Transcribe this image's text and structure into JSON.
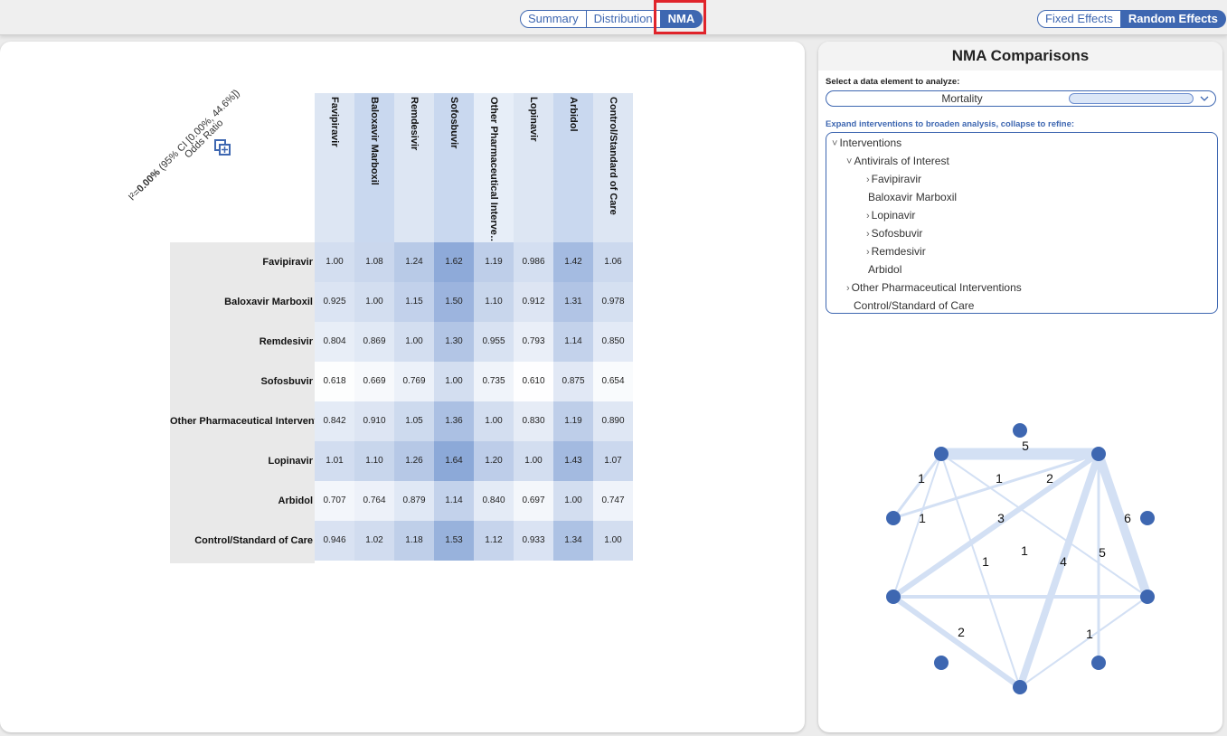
{
  "view_tabs": [
    "Summary",
    "Distribution",
    "NMA"
  ],
  "active_view": "NMA",
  "effect_toggle": [
    "Fixed Effects",
    "Random Effects"
  ],
  "active_effect": "Random Effects",
  "matrix": {
    "measure_label": "Odds Ratio",
    "heterogeneity_prefix": "I²=",
    "heterogeneity_value": "0.00%",
    "heterogeneity_ci": " (95% CI [0.00%, 44.6%])",
    "columns": [
      "Favipiravir",
      "Baloxavir Marboxil",
      "Remdesivir",
      "Sofosbuvir",
      "Other Pharmaceutical Interve…",
      "Lopinavir",
      "Arbidol",
      "Control/Standard of Care"
    ],
    "rows": [
      "Favipiravir",
      "Baloxavir Marboxil",
      "Remdesivir",
      "Sofosbuvir",
      "Other Pharmaceutical Interventi",
      "Lopinavir",
      "Arbidol",
      "Control/Standard of Care"
    ],
    "values": [
      [
        "1.00",
        "1.08",
        "1.24",
        "1.62",
        "1.19",
        "0.986",
        "1.42",
        "1.06"
      ],
      [
        "0.925",
        "1.00",
        "1.15",
        "1.50",
        "1.10",
        "0.912",
        "1.31",
        "0.978"
      ],
      [
        "0.804",
        "0.869",
        "1.00",
        "1.30",
        "0.955",
        "0.793",
        "1.14",
        "0.850"
      ],
      [
        "0.618",
        "0.669",
        "0.769",
        "1.00",
        "0.735",
        "0.610",
        "0.875",
        "0.654"
      ],
      [
        "0.842",
        "0.910",
        "1.05",
        "1.36",
        "1.00",
        "0.830",
        "1.19",
        "0.890"
      ],
      [
        "1.01",
        "1.10",
        "1.26",
        "1.64",
        "1.20",
        "1.00",
        "1.43",
        "1.07"
      ],
      [
        "0.707",
        "0.764",
        "0.879",
        "1.14",
        "0.840",
        "0.697",
        "1.00",
        "0.747"
      ],
      [
        "0.946",
        "1.02",
        "1.18",
        "1.53",
        "1.12",
        "0.933",
        "1.34",
        "1.00"
      ]
    ]
  },
  "side": {
    "title": "NMA Comparisons",
    "select_label": "Select a data element to analyze:",
    "select_value": "Mortality",
    "expand_label": "Expand interventions to broaden analysis, collapse to refine:",
    "tree": [
      {
        "label": "Interventions",
        "caret": "˅"
      },
      {
        "label": "Antivirals of Interest",
        "caret": "˅"
      },
      {
        "label": "Favipiravir",
        "caret": "›"
      },
      {
        "label": "Baloxavir Marboxil",
        "caret": ""
      },
      {
        "label": "Lopinavir",
        "caret": "›"
      },
      {
        "label": "Sofosbuvir",
        "caret": "›"
      },
      {
        "label": "Remdesivir",
        "caret": "›"
      },
      {
        "label": "Arbidol",
        "caret": ""
      },
      {
        "label": "Other Pharmaceutical Interventions",
        "caret": "›"
      },
      {
        "label": "Control/Standard of Care",
        "caret": ""
      }
    ]
  },
  "network": {
    "edge_labels": [
      "5",
      "1",
      "1",
      "2",
      "1",
      "3",
      "6",
      "1",
      "1",
      "4",
      "5",
      "2",
      "1"
    ]
  },
  "colors": {
    "accent": "#3e67b1",
    "node": "#3e67b1",
    "edge": "#d3e0f4",
    "highlight": "#e0242b"
  }
}
